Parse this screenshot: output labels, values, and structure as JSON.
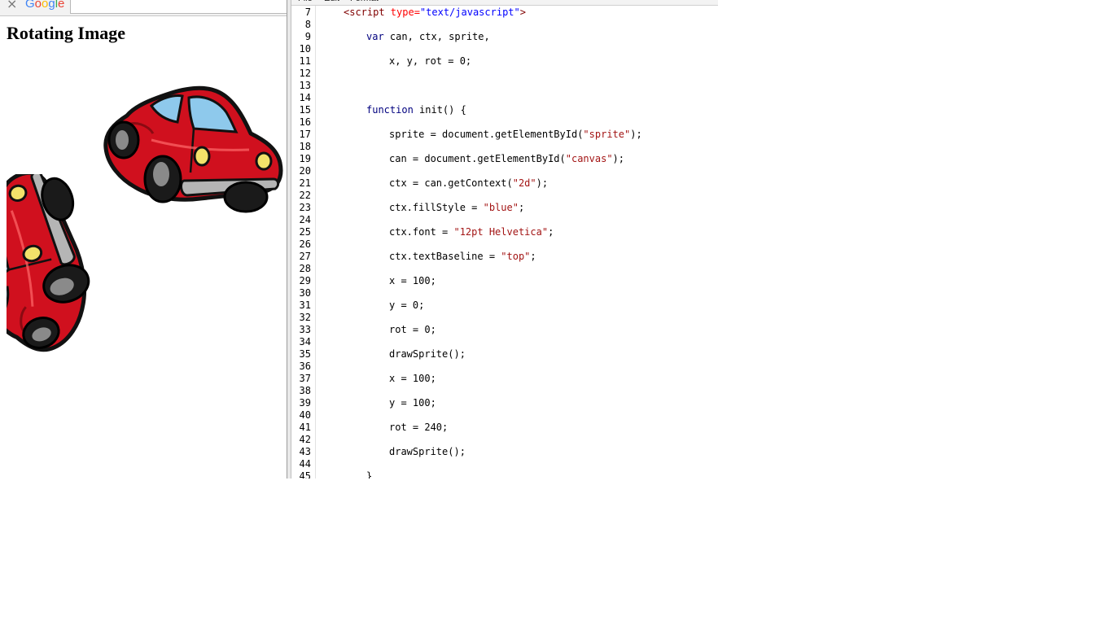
{
  "browser": {
    "close_glyph": "×",
    "logo_letters": [
      {
        "ch": "G",
        "color": "#4285f4"
      },
      {
        "ch": "o",
        "color": "#ea4335"
      },
      {
        "ch": "o",
        "color": "#fbbc05"
      },
      {
        "ch": "g",
        "color": "#4285f4"
      },
      {
        "ch": "l",
        "color": "#34a853"
      },
      {
        "ch": "e",
        "color": "#ea4335"
      }
    ],
    "address_value": "",
    "page_heading": "Rotating Image"
  },
  "sprites": [
    {
      "name": "car-sprite",
      "rotation_deg": 0
    },
    {
      "name": "car-sprite-rotated",
      "rotation_deg": 240
    }
  ],
  "colors": {
    "car_body": "#d0101e",
    "car_window": "#8ec9ec",
    "headlight": "#f2e26a"
  },
  "editor": {
    "menu": [
      "File",
      "Edit",
      "Format"
    ],
    "lines": [
      {
        "n": "7",
        "indent": 4,
        "tokens": [
          {
            "t": "<script ",
            "c": "tag"
          },
          {
            "t": "type=",
            "c": "attr"
          },
          {
            "t": "\"text/javascript\"",
            "c": "attrval"
          },
          {
            "t": ">",
            "c": "tag"
          }
        ]
      },
      {
        "n": "8",
        "indent": 0,
        "tokens": []
      },
      {
        "n": "9",
        "indent": 8,
        "tokens": [
          {
            "t": "var",
            "c": "kw"
          },
          {
            "t": " can, ctx, sprite,",
            "c": ""
          }
        ]
      },
      {
        "n": "10",
        "indent": 0,
        "tokens": []
      },
      {
        "n": "11",
        "indent": 12,
        "tokens": [
          {
            "t": "x, y, rot = 0;",
            "c": ""
          }
        ]
      },
      {
        "n": "12",
        "indent": 0,
        "tokens": []
      },
      {
        "n": "13",
        "indent": 0,
        "tokens": []
      },
      {
        "n": "14",
        "indent": 0,
        "tokens": []
      },
      {
        "n": "15",
        "indent": 8,
        "tokens": [
          {
            "t": "function",
            "c": "kw"
          },
          {
            "t": " init() {",
            "c": ""
          }
        ]
      },
      {
        "n": "16",
        "indent": 0,
        "tokens": []
      },
      {
        "n": "17",
        "indent": 12,
        "tokens": [
          {
            "t": "sprite = document.getElementById(",
            "c": ""
          },
          {
            "t": "\"sprite\"",
            "c": "str"
          },
          {
            "t": ");",
            "c": ""
          }
        ]
      },
      {
        "n": "18",
        "indent": 0,
        "tokens": []
      },
      {
        "n": "19",
        "indent": 12,
        "tokens": [
          {
            "t": "can = document.getElementById(",
            "c": ""
          },
          {
            "t": "\"canvas\"",
            "c": "str"
          },
          {
            "t": ");",
            "c": ""
          }
        ]
      },
      {
        "n": "20",
        "indent": 0,
        "tokens": []
      },
      {
        "n": "21",
        "indent": 12,
        "tokens": [
          {
            "t": "ctx = can.getContext(",
            "c": ""
          },
          {
            "t": "\"2d\"",
            "c": "str"
          },
          {
            "t": ");",
            "c": ""
          }
        ]
      },
      {
        "n": "22",
        "indent": 0,
        "tokens": []
      },
      {
        "n": "23",
        "indent": 12,
        "tokens": [
          {
            "t": "ctx.fillStyle = ",
            "c": ""
          },
          {
            "t": "\"blue\"",
            "c": "str"
          },
          {
            "t": ";",
            "c": ""
          }
        ]
      },
      {
        "n": "24",
        "indent": 0,
        "tokens": []
      },
      {
        "n": "25",
        "indent": 12,
        "tokens": [
          {
            "t": "ctx.font = ",
            "c": ""
          },
          {
            "t": "\"12pt Helvetica\"",
            "c": "str"
          },
          {
            "t": ";",
            "c": ""
          }
        ]
      },
      {
        "n": "26",
        "indent": 0,
        "tokens": []
      },
      {
        "n": "27",
        "indent": 12,
        "tokens": [
          {
            "t": "ctx.textBaseline = ",
            "c": ""
          },
          {
            "t": "\"top\"",
            "c": "str"
          },
          {
            "t": ";",
            "c": ""
          }
        ]
      },
      {
        "n": "28",
        "indent": 0,
        "tokens": []
      },
      {
        "n": "29",
        "indent": 12,
        "tokens": [
          {
            "t": "x = 100;",
            "c": ""
          }
        ]
      },
      {
        "n": "30",
        "indent": 0,
        "tokens": []
      },
      {
        "n": "31",
        "indent": 12,
        "tokens": [
          {
            "t": "y = 0;",
            "c": ""
          }
        ]
      },
      {
        "n": "32",
        "indent": 0,
        "tokens": []
      },
      {
        "n": "33",
        "indent": 12,
        "tokens": [
          {
            "t": "rot = 0;",
            "c": ""
          }
        ]
      },
      {
        "n": "34",
        "indent": 0,
        "tokens": []
      },
      {
        "n": "35",
        "indent": 12,
        "tokens": [
          {
            "t": "drawSprite();",
            "c": ""
          }
        ]
      },
      {
        "n": "36",
        "indent": 0,
        "tokens": []
      },
      {
        "n": "37",
        "indent": 12,
        "tokens": [
          {
            "t": "x = 100;",
            "c": ""
          }
        ]
      },
      {
        "n": "38",
        "indent": 0,
        "tokens": []
      },
      {
        "n": "39",
        "indent": 12,
        "tokens": [
          {
            "t": "y = 100;",
            "c": ""
          }
        ]
      },
      {
        "n": "40",
        "indent": 0,
        "tokens": []
      },
      {
        "n": "41",
        "indent": 12,
        "tokens": [
          {
            "t": "rot = 240;",
            "c": ""
          }
        ]
      },
      {
        "n": "42",
        "indent": 0,
        "tokens": []
      },
      {
        "n": "43",
        "indent": 12,
        "tokens": [
          {
            "t": "drawSprite();",
            "c": ""
          }
        ]
      },
      {
        "n": "44",
        "indent": 0,
        "tokens": []
      },
      {
        "n": "45",
        "indent": 8,
        "tokens": [
          {
            "t": "}",
            "c": ""
          }
        ]
      }
    ]
  }
}
